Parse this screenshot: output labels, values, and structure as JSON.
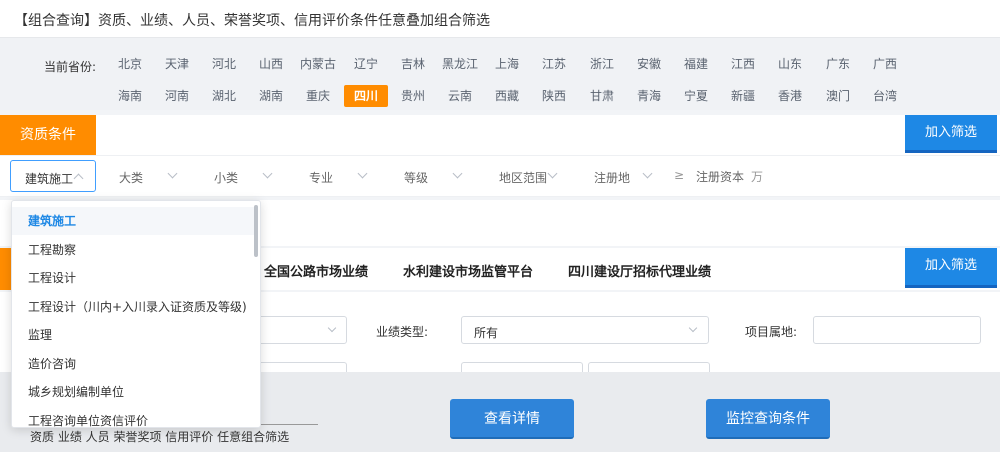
{
  "title": "【组合查询】资质、业绩、人员、荣誉奖项、信用评价条件任意叠加组合筛选",
  "province": {
    "label": "当前省份:",
    "row1": [
      "北京",
      "天津",
      "河北",
      "山西",
      "内蒙古",
      "辽宁",
      "吉林",
      "黑龙江",
      "上海",
      "江苏",
      "浙江",
      "安徽",
      "福建",
      "江西",
      "山东",
      "广东",
      "广西"
    ],
    "row2": [
      "海南",
      "河南",
      "湖北",
      "湖南",
      "重庆",
      "四川",
      "贵州",
      "云南",
      "西藏",
      "陕西",
      "甘肃",
      "青海",
      "宁夏",
      "新疆",
      "香港",
      "澳门",
      "台湾"
    ],
    "selected": "四川"
  },
  "qualification": {
    "tag": "资质条件",
    "add_label": "加入筛选",
    "filters": [
      {
        "name": "construction-type",
        "text": "建筑施工",
        "open": true
      },
      {
        "name": "major-category",
        "text": "大类"
      },
      {
        "name": "minor-category",
        "text": "小类"
      },
      {
        "name": "specialty",
        "text": "专业"
      },
      {
        "name": "grade",
        "text": "等级"
      },
      {
        "name": "region-scope",
        "text": "地区范围"
      },
      {
        "name": "registration-place",
        "text": "注册地"
      }
    ],
    "capital_symbol": "≥",
    "capital_label": "注册资本",
    "capital_unit": "万"
  },
  "dropdown_items": [
    "建筑施工",
    "工程勘察",
    "工程设计",
    "工程设计（川内+入川录入证资质及等级)",
    "监理",
    "造价咨询",
    "城乡规划编制单位",
    "工程咨询单位资信评价"
  ],
  "performance": {
    "add_label": "加入筛选",
    "tabs": [
      "全国公路市场业绩",
      "水利建设市场监管平台",
      "四川建设厅招标代理业绩"
    ]
  },
  "form": {
    "type_label": "业绩类型:",
    "type_value": "所有",
    "location_label": "项目属地:"
  },
  "bottom": {
    "detail_btn": "查看详情",
    "monitor_btn": "监控查询条件",
    "note": "资质 业绩 人员 荣誉奖项 信用评价 任意组合筛选"
  }
}
